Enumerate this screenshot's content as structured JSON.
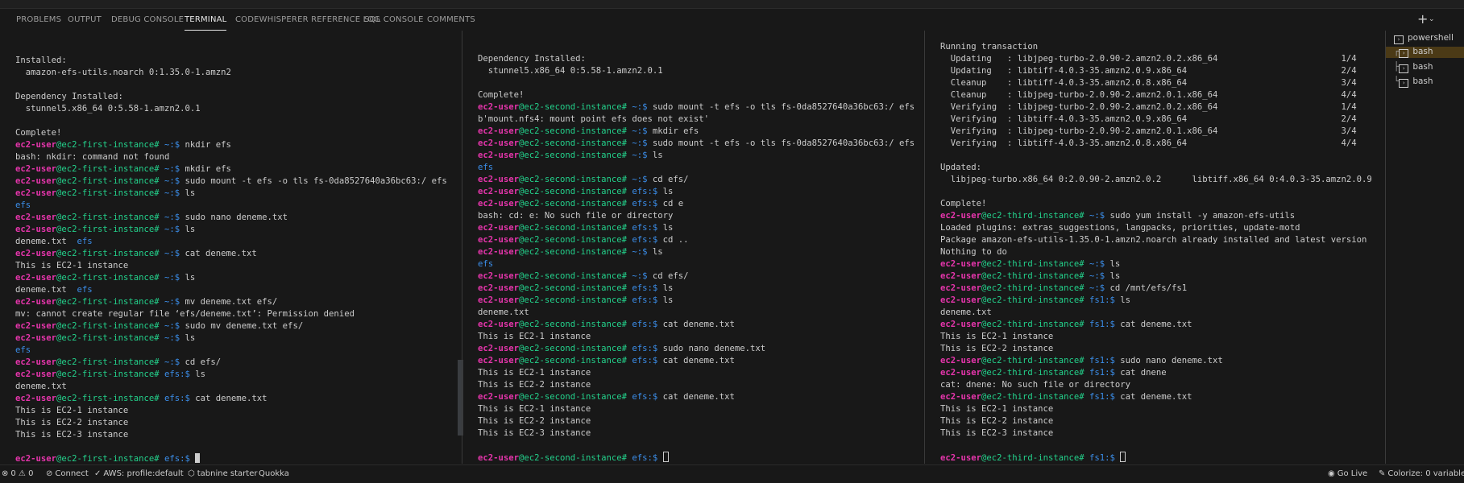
{
  "panel_tabs": [
    "PROBLEMS",
    "OUTPUT",
    "DEBUG CONSOLE",
    "TERMINAL",
    "CODEWHISPERER REFERENCE LOG",
    "SQL CONSOLE",
    "COMMENTS"
  ],
  "active_tab": "TERMINAL",
  "terminal_list": {
    "powershell": "powershell",
    "bash_1": "bash",
    "bash_2": "bash",
    "bash_3": "bash"
  },
  "prompts": {
    "user": "ec2-user",
    "first_host": "@ec2-first-instance#",
    "second_host": "@ec2-second-instance#",
    "third_host": "@ec2-third-instance#",
    "home": "~:$",
    "efs": "efs:$",
    "fs1": "fs1:$"
  },
  "pane1": {
    "l1": "Installed:",
    "l2": "  amazon-efs-utils.noarch 0:1.35.0-1.amzn2",
    "l3": "Dependency Installed:",
    "l4": "  stunnel5.x86_64 0:5.58-1.amzn2.0.1",
    "l5": "Complete!",
    "c1": " nkdir efs",
    "o1": "bash: nkdir: command not found",
    "c2": " mkdir efs",
    "c3": " sudo mount -t efs -o tls fs-0da8527640a36bc63:/ efs",
    "c4": " ls",
    "o2": "efs",
    "c5": " sudo nano deneme.txt",
    "c6": " ls",
    "o3a": "deneme.txt  ",
    "o3b": "efs",
    "c7": " cat deneme.txt",
    "o4": "This is EC2-1 instance",
    "c8": " ls",
    "o5a": "deneme.txt  ",
    "o5b": "efs",
    "c9": " mv deneme.txt efs/",
    "o6": "mv: cannot create regular file ‘efs/deneme.txt’: Permission denied",
    "c10": " sudo mv deneme.txt efs/",
    "c11": " ls",
    "o7": "efs",
    "c12": " cd efs/",
    "c13": " ls",
    "o8": "deneme.txt",
    "c14": " cat deneme.txt",
    "o9": "This is EC2-1 instance",
    "o10": "This is EC2-2 instance",
    "o11": "This is EC2-3 instance"
  },
  "pane2": {
    "l1": "Dependency Installed:",
    "l2": "  stunnel5.x86_64 0:5.58-1.amzn2.0.1",
    "l3": "Complete!",
    "c1": " sudo mount -t efs -o tls fs-0da8527640a36bc63:/ efs",
    "o1": "b'mount.nfs4: mount point efs does not exist'",
    "c2": " mkdir efs",
    "c3": " sudo mount -t efs -o tls fs-0da8527640a36bc63:/ efs",
    "c4": " ls",
    "o2": "efs",
    "c5": " cd efs/",
    "c6": " ls",
    "c7": " cd e",
    "o3": "bash: cd: e: No such file or directory",
    "c8": " ls",
    "c9": " cd ..",
    "c10": " ls",
    "o4": "efs",
    "c11": " cd efs/",
    "c12": " ls",
    "c13": " ls",
    "o5": "deneme.txt",
    "c14": " cat deneme.txt",
    "o6": "This is EC2-1 instance",
    "c15": " sudo nano deneme.txt",
    "c16": " cat deneme.txt",
    "o7": "This is EC2-1 instance",
    "o8": "This is EC2-2 instance",
    "c17": " cat deneme.txt",
    "o9": "This is EC2-1 instance",
    "o10": "This is EC2-2 instance",
    "o11": "This is EC2-3 instance"
  },
  "pane3": {
    "l1": "Running transaction",
    "r1": "  Updating   : libjpeg-turbo-2.0.90-2.amzn2.0.2.x86_64                        1/4",
    "r2": "  Updating   : libtiff-4.0.3-35.amzn2.0.9.x86_64                              2/4",
    "r3": "  Cleanup    : libtiff-4.0.3-35.amzn2.0.8.x86_64                              3/4",
    "r4": "  Cleanup    : libjpeg-turbo-2.0.90-2.amzn2.0.1.x86_64                        4/4",
    "r5": "  Verifying  : libjpeg-turbo-2.0.90-2.amzn2.0.2.x86_64                        1/4",
    "r6": "  Verifying  : libtiff-4.0.3-35.amzn2.0.9.x86_64                              2/4",
    "r7": "  Verifying  : libjpeg-turbo-2.0.90-2.amzn2.0.1.x86_64                        3/4",
    "r8": "  Verifying  : libtiff-4.0.3-35.amzn2.0.8.x86_64                              4/4",
    "l2": "Updated:",
    "l3": "  libjpeg-turbo.x86_64 0:2.0.90-2.amzn2.0.2      libtiff.x86_64 0:4.0.3-35.amzn2.0.9",
    "l4": "Complete!",
    "c1": " sudo yum install -y amazon-efs-utils",
    "o1": "Loaded plugins: extras_suggestions, langpacks, priorities, update-motd",
    "o2": "Package amazon-efs-utils-1.35.0-1.amzn2.noarch already installed and latest version",
    "o3": "Nothing to do",
    "c2": " ls",
    "c3": " ls",
    "c4": " cd /mnt/efs/fs1",
    "c5": " ls",
    "o4": "deneme.txt",
    "c6": " cat deneme.txt",
    "o5": "This is EC2-1 instance",
    "o6": "This is EC2-2 instance",
    "c7": " sudo nano deneme.txt",
    "c8": " cat dnene",
    "o7": "cat: dnene: No such file or directory",
    "c9": " cat deneme.txt",
    "o8": "This is EC2-1 instance",
    "o9": "This is EC2-2 instance",
    "o10": "This is EC2-3 instance"
  },
  "status_bar": {
    "problems": "0 ⚠ 0",
    "connect": "Connect",
    "aws_profile": "AWS: profile:default",
    "tabnine": "tabnine starter",
    "quokka": "Quokka",
    "go_live": "Go Live",
    "colorize": "Colorize: 0 variable"
  },
  "colors": {
    "background": "#181818",
    "user": "#e535ab",
    "host": "#23d18b",
    "path": "#3b8eea",
    "directory": "#3b8eea",
    "selected_terminal": "#4b3a16"
  }
}
